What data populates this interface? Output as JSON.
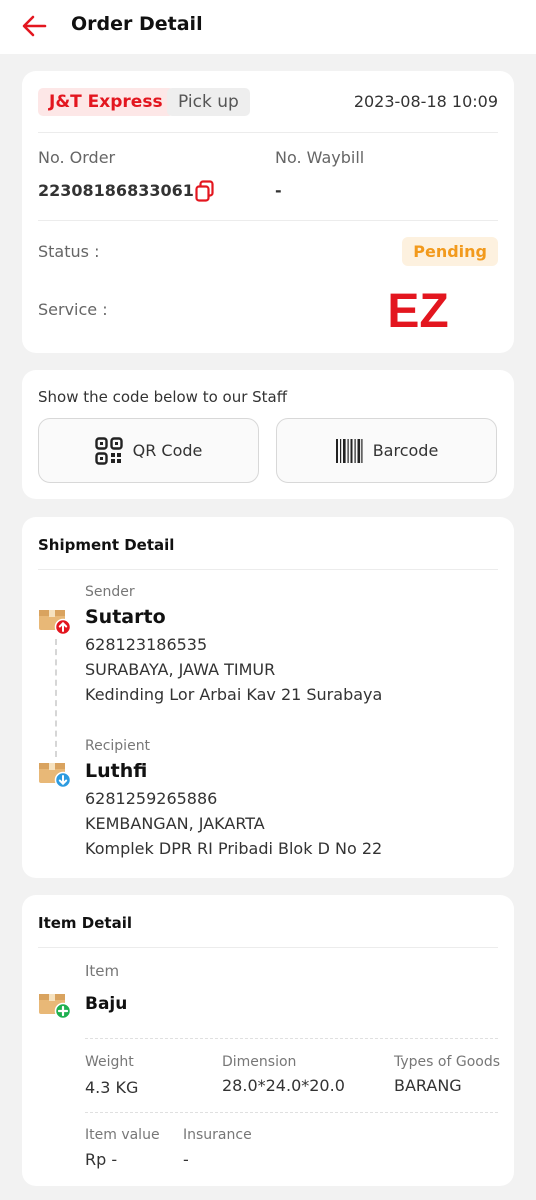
{
  "header": {
    "title": "Order Detail"
  },
  "order": {
    "courier": "J&T Express",
    "mode": "Pick up",
    "datetime": "2023-08-18 10:09",
    "order_no_label": "No. Order",
    "order_no": "22308186833061",
    "waybill_label": "No. Waybill",
    "waybill": "-",
    "status_label": "Status :",
    "status": "Pending",
    "service_label": "Service :",
    "service_logo_text": "EZ"
  },
  "code": {
    "hint": "Show the code below to our Staff",
    "qr_label": "QR Code",
    "barcode_label": "Barcode"
  },
  "shipment": {
    "title": "Shipment Detail",
    "sender": {
      "label": "Sender",
      "name": "Sutarto",
      "phone": "628123186535",
      "city": "SURABAYA, JAWA TIMUR",
      "address": "Kedinding Lor Arbai Kav 21 Surabaya"
    },
    "recipient": {
      "label": "Recipient",
      "name": "Luthfi",
      "phone": "6281259265886",
      "city": "KEMBANGAN, JAKARTA",
      "address": "Komplek DPR RI Pribadi Blok D No 22"
    }
  },
  "item": {
    "title": "Item Detail",
    "item_label": "Item",
    "item_name": "Baju",
    "weight_label": "Weight",
    "weight": "4.3  KG",
    "dimension_label": "Dimension",
    "dimension": "28.0*24.0*20.0",
    "goods_type_label": "Types of Goods",
    "goods_type": "BARANG",
    "value_label": "Item value",
    "value": "Rp -",
    "insurance_label": "Insurance",
    "insurance": "-"
  },
  "colors": {
    "brand_red": "#e3161f",
    "pending_orange": "#f29a1d",
    "upload_red": "#e3161f",
    "download_blue": "#2d9be0",
    "add_green": "#1eb050"
  },
  "icons": {
    "back": "arrow-left-icon",
    "copy": "copy-icon",
    "qr": "qr-code-icon",
    "barcode": "barcode-icon",
    "sender": "package-upload-icon",
    "recipient": "package-download-icon",
    "item": "package-add-icon"
  }
}
